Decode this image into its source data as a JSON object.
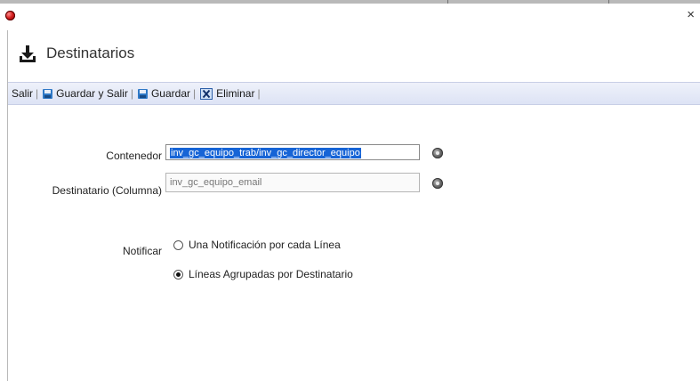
{
  "window": {
    "close_glyph": "×",
    "app_icon": "red-ball-icon"
  },
  "page": {
    "title": "Destinatarios",
    "title_icon": "download-icon"
  },
  "toolbar": {
    "salir": "Salir",
    "guardar_y_salir": "Guardar y Salir",
    "guardar": "Guardar",
    "eliminar": "Eliminar",
    "separator": "|"
  },
  "form": {
    "contenedor": {
      "label": "Contenedor",
      "value": "inv_gc_equipo_trab/inv_gc_director_equipo"
    },
    "destinatario": {
      "label": "Destinatario (Columna)",
      "value": "inv_gc_equipo_email"
    },
    "notificar": {
      "label": "Notificar",
      "options": [
        {
          "label": "Una Notificación por cada Línea",
          "selected": false
        },
        {
          "label": "Líneas Agrupadas por Destinatario",
          "selected": true
        }
      ]
    }
  },
  "colors": {
    "toolbar_bg": "#dde3f5",
    "selection": "#1664d6",
    "app_icon": "#d21c1c"
  }
}
